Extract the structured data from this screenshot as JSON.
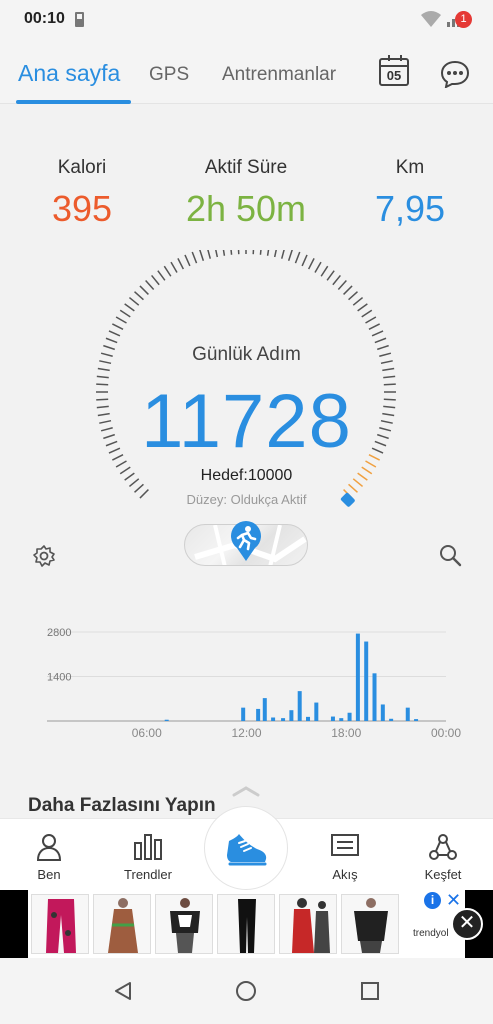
{
  "status_bar": {
    "time": "00:10"
  },
  "top_nav": {
    "tabs": [
      {
        "label": "Ana sayfa",
        "active": true
      },
      {
        "label": "GPS",
        "active": false
      },
      {
        "label": "Antrenmanlar",
        "active": false
      }
    ],
    "calendar_day": "05",
    "messages_badge": "1"
  },
  "stats": [
    {
      "label": "Kalori",
      "value": "395",
      "color": "#ec5b2c"
    },
    {
      "label": "Aktif Süre",
      "value": "2h 50m",
      "color": "#7cb342"
    },
    {
      "label": "Km",
      "value": "7,95",
      "color": "#2a8ee0"
    }
  ],
  "gauge": {
    "title": "Günlük Adım",
    "steps": "11728",
    "goal": "Hedef:10000",
    "level": "Düzey: Oldukça Aktif",
    "progress_fraction": 1.0
  },
  "chart_data": {
    "type": "bar",
    "x_ticks": [
      "06:00",
      "12:00",
      "18:00",
      "00:00"
    ],
    "y_ticks": [
      "2800",
      "1400"
    ],
    "ylim": [
      0,
      2800
    ],
    "grid": true,
    "series": [
      {
        "values": [
          {
            "hour": 7.2,
            "value": 40
          },
          {
            "hour": 11.8,
            "value": 420
          },
          {
            "hour": 12.7,
            "value": 380
          },
          {
            "hour": 13.1,
            "value": 720
          },
          {
            "hour": 13.6,
            "value": 110
          },
          {
            "hour": 14.2,
            "value": 90
          },
          {
            "hour": 14.7,
            "value": 340
          },
          {
            "hour": 15.2,
            "value": 940
          },
          {
            "hour": 15.7,
            "value": 130
          },
          {
            "hour": 16.2,
            "value": 580
          },
          {
            "hour": 17.2,
            "value": 140
          },
          {
            "hour": 17.7,
            "value": 90
          },
          {
            "hour": 18.2,
            "value": 260
          },
          {
            "hour": 18.7,
            "value": 2750
          },
          {
            "hour": 19.2,
            "value": 2500
          },
          {
            "hour": 19.7,
            "value": 1500
          },
          {
            "hour": 20.2,
            "value": 520
          },
          {
            "hour": 20.7,
            "value": 70
          },
          {
            "hour": 21.7,
            "value": 420
          },
          {
            "hour": 22.2,
            "value": 60
          }
        ]
      }
    ]
  },
  "more_section": {
    "title": "Daha Fazlasını Yapın"
  },
  "bottom_nav": [
    {
      "label": "Ben"
    },
    {
      "label": "Trendler"
    },
    {
      "label": "Akış"
    },
    {
      "label": "Keşfet"
    }
  ],
  "ad": {
    "brand": "trendyol"
  },
  "colors": {
    "accent": "#2a8ee0",
    "calorie": "#ec5b2c",
    "active": "#7cb342",
    "badge": "#e53935"
  }
}
